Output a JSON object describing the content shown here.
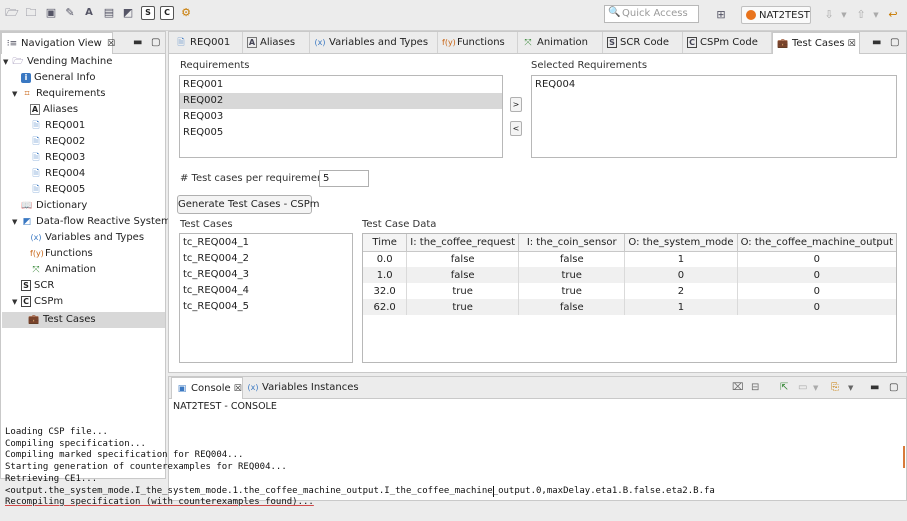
{
  "toolbar": {
    "quick_access_placeholder": "Quick Access",
    "perspective_label": "NAT2TEST"
  },
  "nav": {
    "title": "Navigation View",
    "tree": [
      {
        "label": "Vending Machine",
        "icon": "folder-icon"
      },
      {
        "label": "General Info",
        "icon": "info-icon"
      },
      {
        "label": "Requirements",
        "icon": "requirements-icon"
      },
      {
        "label": "Aliases",
        "icon": "alias-icon"
      },
      {
        "label": "REQ001",
        "icon": "document-icon"
      },
      {
        "label": "REQ002",
        "icon": "document-icon"
      },
      {
        "label": "REQ003",
        "icon": "document-icon"
      },
      {
        "label": "REQ004",
        "icon": "document-icon"
      },
      {
        "label": "REQ005",
        "icon": "document-icon"
      },
      {
        "label": "Dictionary",
        "icon": "dictionary-icon"
      },
      {
        "label": "Data-flow Reactive System",
        "icon": "dfrs-icon"
      },
      {
        "label": "Variables and Types",
        "icon": "variables-icon"
      },
      {
        "label": "Functions",
        "icon": "functions-icon"
      },
      {
        "label": "Animation",
        "icon": "animation-icon"
      },
      {
        "label": "SCR",
        "icon": "scr-icon"
      },
      {
        "label": "CSPm",
        "icon": "cspm-icon"
      },
      {
        "label": "Test Cases",
        "icon": "test-cases-icon"
      }
    ]
  },
  "editor_tabs": [
    "REQ001",
    "Aliases",
    "Variables and Types",
    "Functions",
    "Animation",
    "SCR Code",
    "CSPm Code",
    "Test Cases"
  ],
  "requirements": {
    "label": "Requirements",
    "items": [
      "REQ001",
      "REQ002",
      "REQ003",
      "REQ005"
    ],
    "selected_label": "Selected Requirements",
    "selected_items": [
      "REQ004"
    ],
    "add_button": ">",
    "remove_button": "<"
  },
  "per_req": {
    "label": "# Test cases per requirement",
    "value": "5"
  },
  "generate_button": "Generate Test Cases - CSPm",
  "test_cases": {
    "label": "Test Cases",
    "items": [
      "tc_REQ004_1",
      "tc_REQ004_2",
      "tc_REQ004_3",
      "tc_REQ004_4",
      "tc_REQ004_5"
    ]
  },
  "test_case_data": {
    "label": "Test Case Data",
    "columns": [
      "Time",
      "I: the_coffee_request",
      "I: the_coin_sensor",
      "O: the_system_mode",
      "O: the_coffee_machine_output"
    ],
    "rows": [
      [
        "0.0",
        "false",
        "false",
        "1",
        "0"
      ],
      [
        "1.0",
        "false",
        "true",
        "0",
        "0"
      ],
      [
        "32.0",
        "true",
        "true",
        "2",
        "0"
      ],
      [
        "62.0",
        "true",
        "false",
        "1",
        "0"
      ]
    ]
  },
  "console": {
    "tabs": [
      "Console",
      "Variables Instances"
    ],
    "header": "NAT2TEST - CONSOLE",
    "lines": [
      "Loading CSP file...",
      "Compiling specification...",
      "Compiling marked specification for REQ004...",
      "Starting generation of counterexamples for REQ004...",
      "Retrieving CE1...",
      "<output.the_system_mode.I_the_system_mode.1.the_coffee_machine_output.I_the_coffee_machine_output.0,maxDelay.eta1.B.false.eta2.B.fa",
      "Recompiling specification (with counterexamples found)..."
    ]
  },
  "colors": {
    "accent": "#3a78c2",
    "selection": "#d8d8d8"
  }
}
